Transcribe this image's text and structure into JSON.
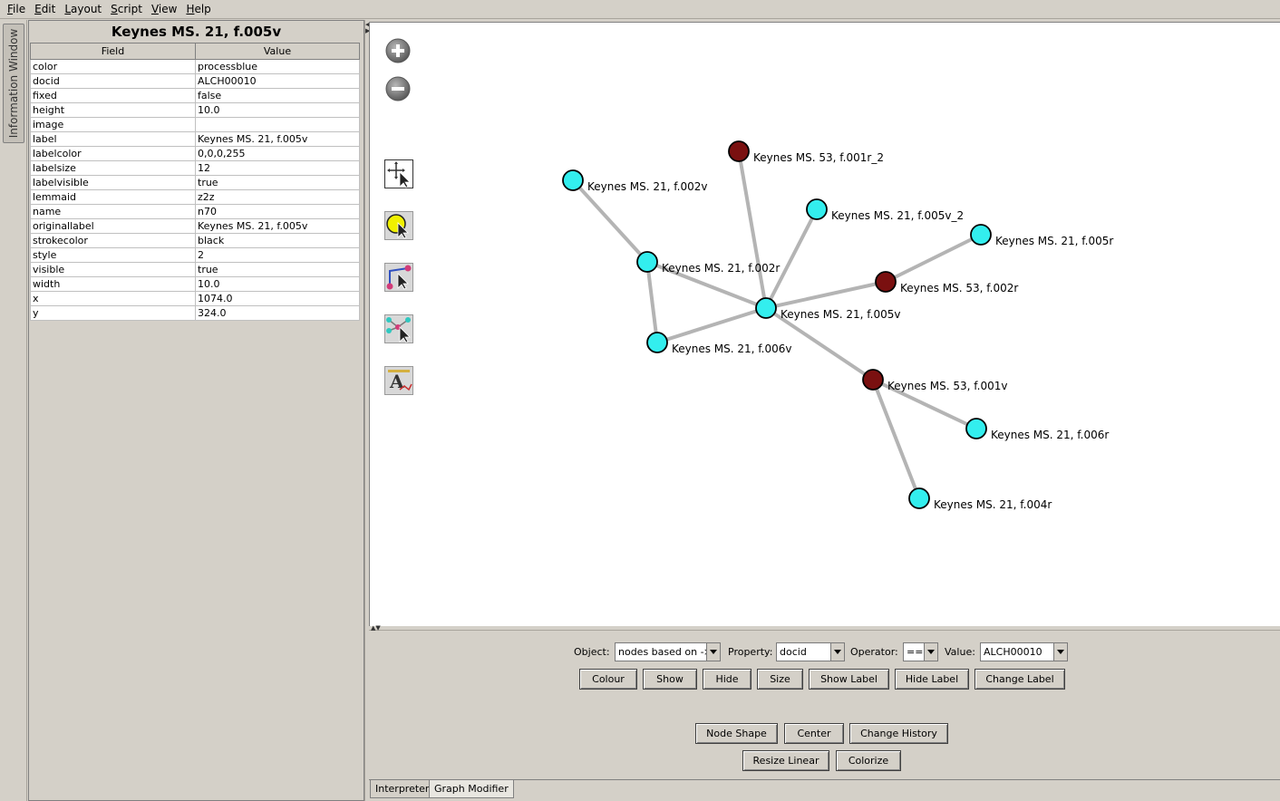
{
  "menu": [
    {
      "label": "File",
      "mn": "F",
      "rest": "ile"
    },
    {
      "label": "Edit",
      "mn": "E",
      "rest": "dit"
    },
    {
      "label": "Layout",
      "mn": "L",
      "rest": "ayout"
    },
    {
      "label": "Script",
      "mn": "S",
      "rest": "cript"
    },
    {
      "label": "View",
      "mn": "V",
      "rest": "iew"
    },
    {
      "label": "Help",
      "mn": "H",
      "rest": "elp"
    }
  ],
  "side_tab": "Information Window",
  "info": {
    "title": "Keynes MS. 21, f.005v",
    "col_field": "Field",
    "col_value": "Value",
    "rows": [
      {
        "field": "color",
        "value": "processblue"
      },
      {
        "field": "docid",
        "value": "ALCH00010"
      },
      {
        "field": "fixed",
        "value": "false"
      },
      {
        "field": "height",
        "value": "10.0"
      },
      {
        "field": "image",
        "value": ""
      },
      {
        "field": "label",
        "value": "Keynes MS. 21, f.005v"
      },
      {
        "field": "labelcolor",
        "value": "0,0,0,255"
      },
      {
        "field": "labelsize",
        "value": "12"
      },
      {
        "field": "labelvisible",
        "value": "true"
      },
      {
        "field": "lemmaid",
        "value": "z2z"
      },
      {
        "field": "name",
        "value": "n70"
      },
      {
        "field": "originallabel",
        "value": "Keynes MS. 21, f.005v"
      },
      {
        "field": "strokecolor",
        "value": "black"
      },
      {
        "field": "style",
        "value": "2"
      },
      {
        "field": "visible",
        "value": "true"
      },
      {
        "field": "width",
        "value": "10.0"
      },
      {
        "field": "x",
        "value": "1074.0"
      },
      {
        "field": "y",
        "value": "324.0"
      }
    ]
  },
  "tools": [
    "zoom-in-icon",
    "zoom-out-icon",
    "move-select-icon",
    "node-select-icon",
    "edge-create-icon",
    "graph-select-icon",
    "text-label-icon"
  ],
  "colors": {
    "cyan_node": "#33eeee",
    "red_node": "#7a1010",
    "edge": "#b4b4b4"
  },
  "graph": {
    "nodes": [
      {
        "id": "n70",
        "label": "Keynes MS. 21, f.005v",
        "type": "cyan"
      },
      {
        "id": "n1",
        "label": "Keynes MS. 53, f.001r_2",
        "type": "red"
      },
      {
        "id": "n2",
        "label": "Keynes MS. 21, f.002v",
        "type": "cyan"
      },
      {
        "id": "n3",
        "label": "Keynes MS. 21, f.005v_2",
        "type": "cyan"
      },
      {
        "id": "n4",
        "label": "Keynes MS. 21, f.005r",
        "type": "cyan"
      },
      {
        "id": "n5",
        "label": "Keynes MS. 53, f.002r",
        "type": "red"
      },
      {
        "id": "n6",
        "label": "Keynes MS. 21, f.002r",
        "type": "cyan"
      },
      {
        "id": "n7",
        "label": "Keynes MS. 21, f.006v",
        "type": "cyan"
      },
      {
        "id": "n8",
        "label": "Keynes MS. 53, f.001v",
        "type": "red"
      },
      {
        "id": "n9",
        "label": "Keynes MS. 21, f.006r",
        "type": "cyan"
      },
      {
        "id": "n10",
        "label": "Keynes MS. 21, f.004r",
        "type": "cyan"
      }
    ],
    "edges": [
      [
        "n70",
        "n1"
      ],
      [
        "n70",
        "n3"
      ],
      [
        "n70",
        "n5"
      ],
      [
        "n70",
        "n6"
      ],
      [
        "n70",
        "n7"
      ],
      [
        "n70",
        "n8"
      ],
      [
        "n5",
        "n4"
      ],
      [
        "n6",
        "n2"
      ],
      [
        "n6",
        "n7"
      ],
      [
        "n8",
        "n9"
      ],
      [
        "n8",
        "n10"
      ]
    ]
  },
  "modifier": {
    "object_label": "Object:",
    "object_value": "nodes based on ->",
    "property_label": "Property:",
    "property_value": "docid",
    "operator_label": "Operator:",
    "operator_value": "==",
    "value_label": "Value:",
    "value_value": "ALCH00010",
    "buttons_row1": [
      "Colour",
      "Show",
      "Hide",
      "Size",
      "Show Label",
      "Hide Label",
      "Change Label"
    ],
    "buttons_row2": [
      "Node Shape",
      "Center",
      "Change History"
    ],
    "buttons_row3": [
      "Resize Linear",
      "Colorize"
    ]
  },
  "bottom_tabs": [
    {
      "label": "Interpreter",
      "active": false
    },
    {
      "label": "Graph Modifier",
      "active": true
    }
  ]
}
